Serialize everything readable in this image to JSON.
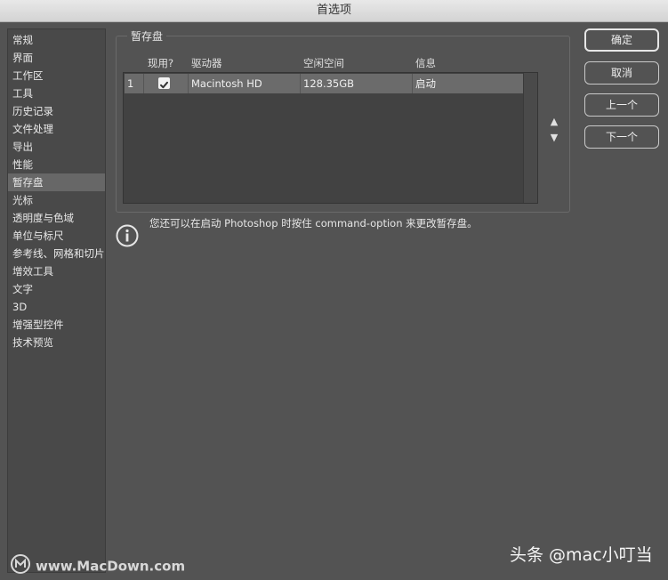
{
  "window": {
    "title": "首选项"
  },
  "sidebar": {
    "items": [
      {
        "label": "常规"
      },
      {
        "label": "界面"
      },
      {
        "label": "工作区"
      },
      {
        "label": "工具"
      },
      {
        "label": "历史记录"
      },
      {
        "label": "文件处理"
      },
      {
        "label": "导出"
      },
      {
        "label": "性能"
      },
      {
        "label": "暂存盘",
        "selected": true
      },
      {
        "label": "光标"
      },
      {
        "label": "透明度与色域"
      },
      {
        "label": "单位与标尺"
      },
      {
        "label": "参考线、网格和切片"
      },
      {
        "label": "增效工具"
      },
      {
        "label": "文字"
      },
      {
        "label": "3D"
      },
      {
        "label": "增强型控件"
      },
      {
        "label": "技术预览"
      }
    ]
  },
  "scratch_disks": {
    "group_title": "暂存盘",
    "columns": [
      "现用?",
      "驱动器",
      "空闲空间",
      "信息"
    ],
    "rows": [
      {
        "index": "1",
        "active": true,
        "drive": "Macintosh HD",
        "free_space": "128.35GB",
        "info": "启动"
      }
    ],
    "move_up_icon": "triangle-up-icon",
    "move_down_icon": "triangle-down-icon"
  },
  "info": {
    "icon": "info-circle-icon",
    "text": "您还可以在启动 Photoshop 时按住 command-option 来更改暂存盘。"
  },
  "buttons": {
    "ok": "确定",
    "cancel": "取消",
    "prev": "上一个",
    "next": "下一个"
  },
  "watermarks": {
    "left": "www.MacDown.com",
    "right": "头条 @mac小叮当"
  }
}
